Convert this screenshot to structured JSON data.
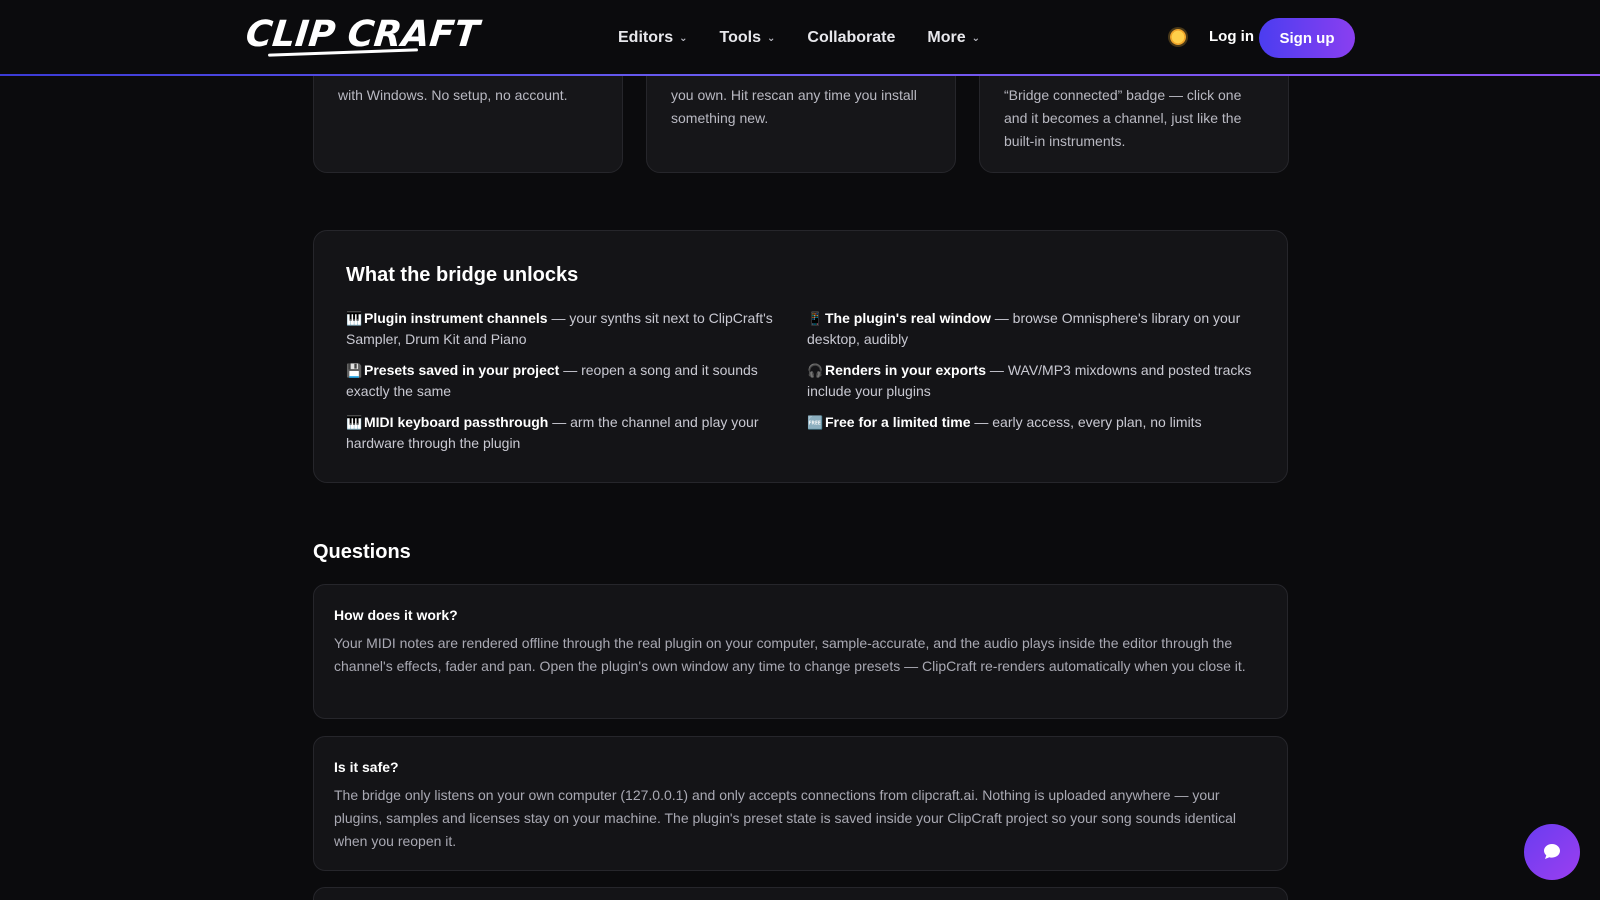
{
  "brand": {
    "logo": "CLIP CRAFT"
  },
  "nav": {
    "items": [
      {
        "label": "Editors",
        "dropdown": true
      },
      {
        "label": "Tools",
        "dropdown": true
      },
      {
        "label": "Collaborate",
        "dropdown": false
      },
      {
        "label": "More",
        "dropdown": true
      }
    ],
    "login": "Log in",
    "signup": "Sign up"
  },
  "colors": {
    "accent_start": "#4b3df0",
    "accent_end": "#8a3ff0",
    "background": "#0b0b0d"
  },
  "top_cards": [
    {
      "text": "with Windows. No setup, no account."
    },
    {
      "text": "you own. Hit rescan any time you install something new."
    },
    {
      "text": "“Bridge connected” badge — click one and it becomes a channel, just like the built-in instruments."
    }
  ],
  "unlocks": {
    "title": "What the bridge unlocks",
    "features": [
      {
        "emoji": "🎹",
        "title": "Plugin instrument channels",
        "desc": " — your synths sit next to ClipCraft's Sampler, Drum Kit and Piano"
      },
      {
        "emoji": "📱",
        "title": "The plugin's real window",
        "desc": " — browse Omnisphere's library on your desktop, audibly"
      },
      {
        "emoji": "💾",
        "title": "Presets saved in your project",
        "desc": " — reopen a song and it sounds exactly the same"
      },
      {
        "emoji": "🎧",
        "title": "Renders in your exports",
        "desc": " — WAV/MP3 mixdowns and posted tracks include your plugins"
      },
      {
        "emoji": "🎹",
        "title": "MIDI keyboard passthrough",
        "desc": " — arm the channel and play your hardware through the plugin"
      },
      {
        "emoji": "🆓",
        "title": "Free for a limited time",
        "desc": " — early access, every plan, no limits"
      }
    ]
  },
  "questions": {
    "title": "Questions",
    "items": [
      {
        "q": "How does it work?",
        "a": "Your MIDI notes are rendered offline through the real plugin on your computer, sample-accurate, and the audio plays inside the editor through the channel's effects, fader and pan. Open the plugin's own window any time to change presets — ClipCraft re-renders automatically when you close it."
      },
      {
        "q": "Is it safe?",
        "a": "The bridge only listens on your own computer (127.0.0.1) and only accepts connections from clipcraft.ai. Nothing is uploaded anywhere — your plugins, samples and licenses stay on your machine. The plugin's preset state is saved inside your ClipCraft project so your song sounds identical when you reopen it."
      }
    ]
  },
  "icons": {
    "theme": "sun-icon",
    "chat": "chat-bubble-icon"
  }
}
